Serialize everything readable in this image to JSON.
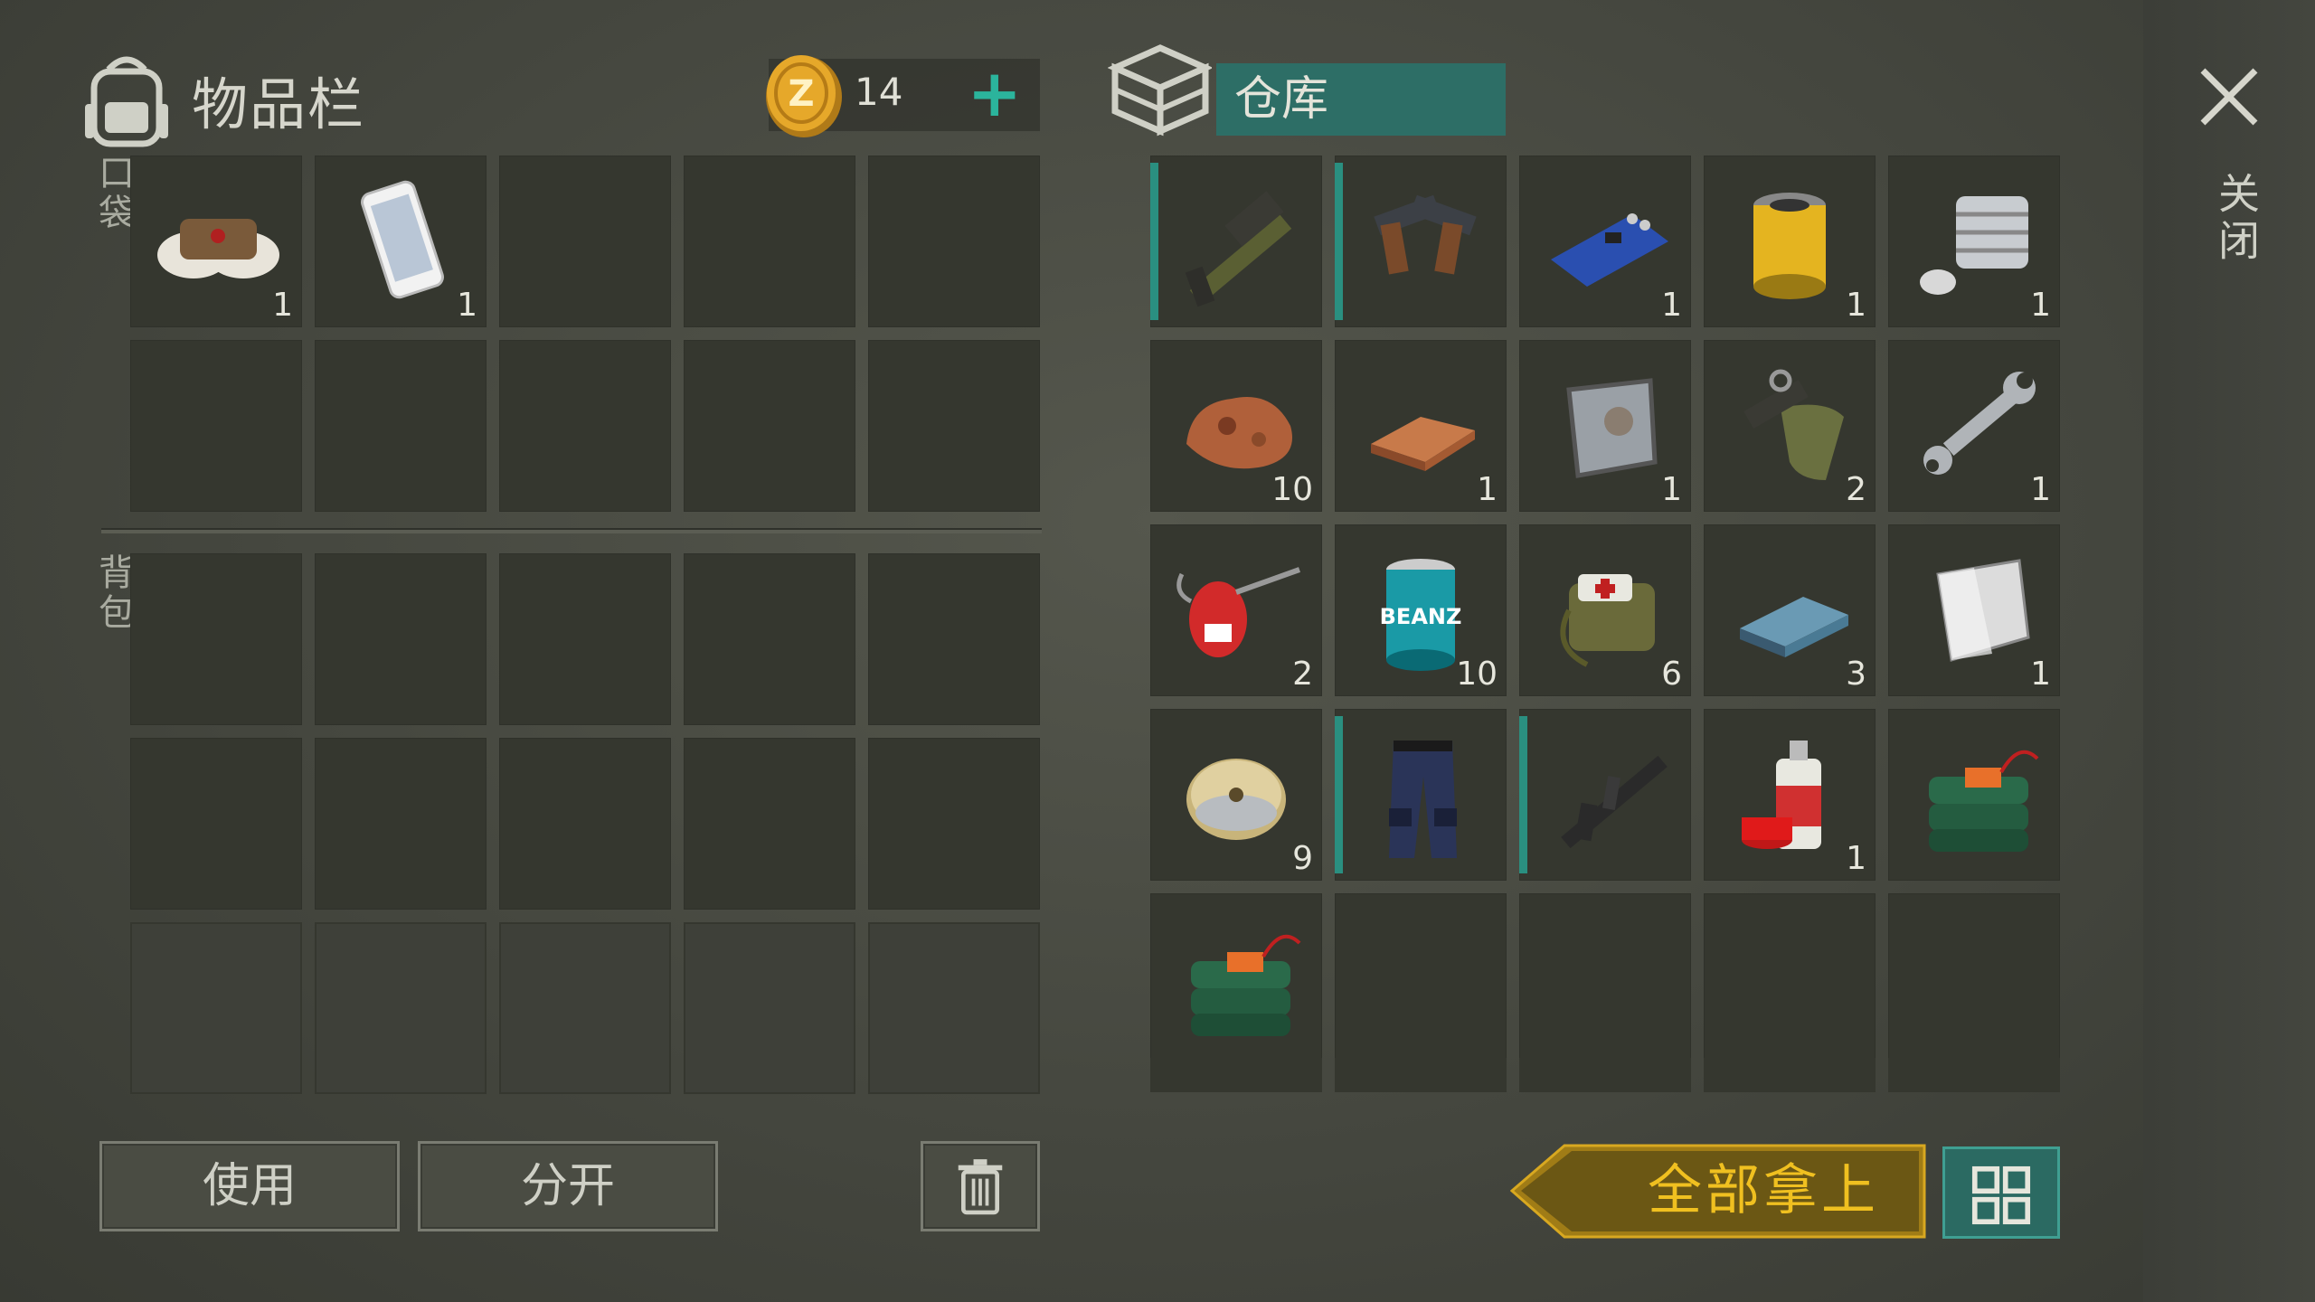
{
  "inventory": {
    "title": "物品栏",
    "currency": {
      "icon": "coin-icon",
      "amount": "14",
      "add_label": "+"
    },
    "pocket_label": "口袋",
    "backpack_label": "背包",
    "pocket_slots": [
      {
        "icon": "bandage-icon",
        "qty": "1"
      },
      {
        "icon": "smartphone-icon",
        "qty": "1"
      },
      {
        "icon": "",
        "qty": ""
      },
      {
        "icon": "",
        "qty": ""
      },
      {
        "icon": "",
        "qty": ""
      },
      {
        "icon": "",
        "qty": ""
      },
      {
        "icon": "",
        "qty": ""
      },
      {
        "icon": "",
        "qty": ""
      },
      {
        "icon": "",
        "qty": ""
      },
      {
        "icon": "",
        "qty": ""
      }
    ],
    "backpack_rows": 3
  },
  "storage": {
    "title": "仓库",
    "slots": [
      {
        "icon": "grenade-launcher-icon",
        "qty": "",
        "equipped": true
      },
      {
        "icon": "dual-pistols-icon",
        "qty": "",
        "equipped": true
      },
      {
        "icon": "circuit-board-icon",
        "qty": "1"
      },
      {
        "icon": "oil-filter-icon",
        "qty": "1"
      },
      {
        "icon": "engine-cylinder-icon",
        "qty": "1"
      },
      {
        "icon": "copper-ore-icon",
        "qty": "10"
      },
      {
        "icon": "copper-ingot-icon",
        "qty": "1"
      },
      {
        "icon": "metal-plate-icon",
        "qty": "1"
      },
      {
        "icon": "rifle-parts-icon",
        "qty": "2"
      },
      {
        "icon": "wrench-icon",
        "qty": "1"
      },
      {
        "icon": "oil-can-icon",
        "qty": "2"
      },
      {
        "icon": "beans-can-icon",
        "qty": "10"
      },
      {
        "icon": "medkit-bag-icon",
        "qty": "6"
      },
      {
        "icon": "steel-ingot-icon",
        "qty": "3"
      },
      {
        "icon": "aluminum-sheet-icon",
        "qty": "1"
      },
      {
        "icon": "wire-spool-icon",
        "qty": "9"
      },
      {
        "icon": "tactical-pants-icon",
        "qty": "",
        "equipped": true
      },
      {
        "icon": "assault-rifle-icon",
        "qty": "",
        "equipped": true
      },
      {
        "icon": "spray-paint-icon",
        "qty": "1"
      },
      {
        "icon": "c4-explosive-icon",
        "qty": ""
      },
      {
        "icon": "c4-explosive-icon",
        "qty": ""
      },
      {
        "icon": "",
        "qty": ""
      },
      {
        "icon": "",
        "qty": ""
      },
      {
        "icon": "",
        "qty": ""
      },
      {
        "icon": "",
        "qty": ""
      }
    ]
  },
  "buttons": {
    "use": "使用",
    "split": "分开",
    "take_all": "全部拿上",
    "close": "关闭"
  },
  "colors": {
    "accent_teal": "#2d6e66",
    "gold": "#f0c020",
    "slot": "#35372f"
  }
}
